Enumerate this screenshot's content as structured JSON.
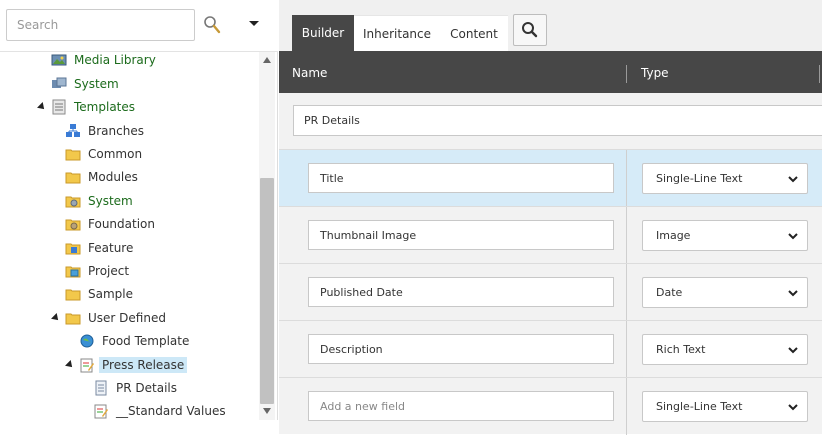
{
  "search": {
    "placeholder": "Search"
  },
  "tree": [
    {
      "label": "Media Library",
      "icon": "media-library-icon",
      "green": true
    },
    {
      "label": "System",
      "icon": "system-icon",
      "green": true
    },
    {
      "label": "Templates",
      "icon": "templates-icon",
      "green": true
    },
    {
      "label": "Branches",
      "icon": "branches-icon",
      "green": false
    },
    {
      "label": "Common",
      "icon": "folder-icon",
      "green": false
    },
    {
      "label": "Modules",
      "icon": "folder-icon",
      "green": false
    },
    {
      "label": "System",
      "icon": "system-folder-icon",
      "green": true
    },
    {
      "label": "Foundation",
      "icon": "foundation-folder-icon",
      "green": false
    },
    {
      "label": "Feature",
      "icon": "feature-folder-icon",
      "green": false
    },
    {
      "label": "Project",
      "icon": "project-folder-icon",
      "green": false
    },
    {
      "label": "Sample",
      "icon": "folder-icon",
      "green": false
    },
    {
      "label": "User Defined",
      "icon": "folder-icon",
      "green": false
    },
    {
      "label": "Food Template",
      "icon": "globe-template-icon",
      "green": false
    },
    {
      "label": "Press Release",
      "icon": "template-edit-icon",
      "green": false,
      "selected": true
    },
    {
      "label": "PR Details",
      "icon": "section-document-icon",
      "green": false
    },
    {
      "label": "__Standard Values",
      "icon": "standard-values-icon",
      "green": false
    }
  ],
  "tabs": {
    "builder": "Builder",
    "inheritance": "Inheritance",
    "content": "Content"
  },
  "header": {
    "name": "Name",
    "type": "Type"
  },
  "section": {
    "value": "PR Details"
  },
  "fields": [
    {
      "name": "Title",
      "type": "Single-Line Text"
    },
    {
      "name": "Thumbnail Image",
      "type": "Image"
    },
    {
      "name": "Published Date",
      "type": "Date"
    },
    {
      "name": "Description",
      "type": "Rich Text"
    }
  ],
  "new_field": {
    "placeholder": "Add a new field",
    "type": "Single-Line Text"
  },
  "colors": {
    "accent_dark": "#474747",
    "selected_row": "#d6ebf8",
    "tree_green": "#1c6b1c"
  }
}
